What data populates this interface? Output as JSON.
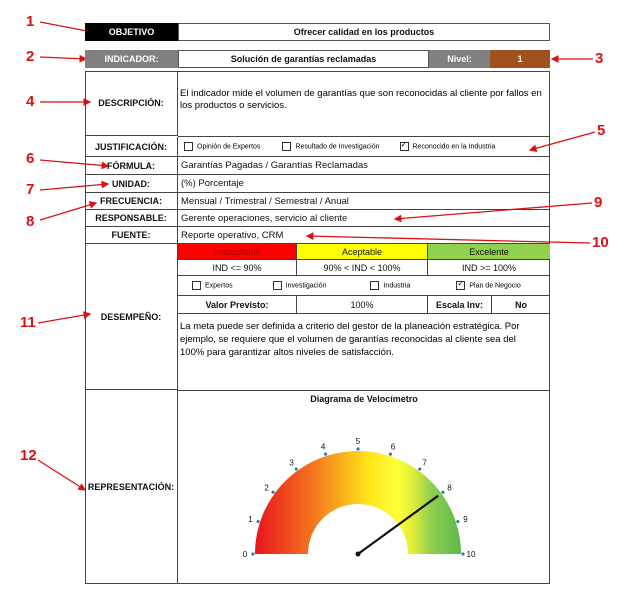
{
  "callouts": [
    "1",
    "2",
    "3",
    "4",
    "5",
    "6",
    "7",
    "8",
    "9",
    "10",
    "11",
    "12"
  ],
  "objetivo": {
    "label": "OBJETIVO",
    "value": "Ofrecer calidad en los productos"
  },
  "indicador": {
    "label": "INDICADOR:",
    "value": "Solución de garantías reclamadas",
    "nivel_label": "Nivel:",
    "nivel_value": "1"
  },
  "descripcion": {
    "label": "DESCRIPCIÓN:",
    "value": "El indicador mide el volumen de garantías que son reconocidas al cliente por fallos en los productos o servicios."
  },
  "justificacion": {
    "label": "JUSTIFICACIÓN:",
    "options": [
      {
        "text": "Opinión de Expertos",
        "checked": false
      },
      {
        "text": "Resultado de Investigación",
        "checked": false
      },
      {
        "text": "Reconocido en la Industria",
        "checked": true
      }
    ]
  },
  "formula": {
    "label": "FÓRMULA:",
    "value": "Garantías Pagadas / Garantías Reclamadas"
  },
  "unidad": {
    "label": "UNIDAD:",
    "value": "(%) Porcentaje"
  },
  "frecuencia": {
    "label": "FRECUENCIA:",
    "value": "Mensual / Trimestral / Semestral / Anual"
  },
  "responsable": {
    "label": "RESPONSABLE:",
    "value": "Gerente operaciones, servicio al cliente"
  },
  "fuente": {
    "label": "FUENTE:",
    "value": "Reporte operativo, CRM"
  },
  "desempeno": {
    "label": "DESEMPEÑO:",
    "levels": [
      {
        "name": "Inaceptable",
        "range": "IND <= 90%",
        "color": "#ff0000"
      },
      {
        "name": "Aceptable",
        "range": "90% < IND < 100%",
        "color": "#ffff00"
      },
      {
        "name": "Excelente",
        "range": "IND >= 100%",
        "color": "#92d050"
      }
    ],
    "options": [
      {
        "text": "Expertos",
        "checked": false
      },
      {
        "text": "Investigación",
        "checked": false
      },
      {
        "text": "Industria",
        "checked": false
      },
      {
        "text": "Plan de Negocio",
        "checked": true
      }
    ],
    "valor_label": "Valor Previsto:",
    "valor": "100%",
    "escala_label": "Escala Inv:",
    "escala": "No",
    "nota": "La meta puede ser definida a criterio del gestor de la planeación estratégica. Por ejemplo, se requiere que el volumen de garantías reconocidas al cliente sea del 100% para garantizar altos niveles de satisfacción."
  },
  "representacion": {
    "label": "REPRESENTACIÓN:",
    "title": "Diagrama de Velocímetro",
    "gauge_ticks": [
      "0",
      "1",
      "2",
      "3",
      "4",
      "5",
      "6",
      "7",
      "8",
      "9",
      "10"
    ],
    "needle_value": 8
  }
}
